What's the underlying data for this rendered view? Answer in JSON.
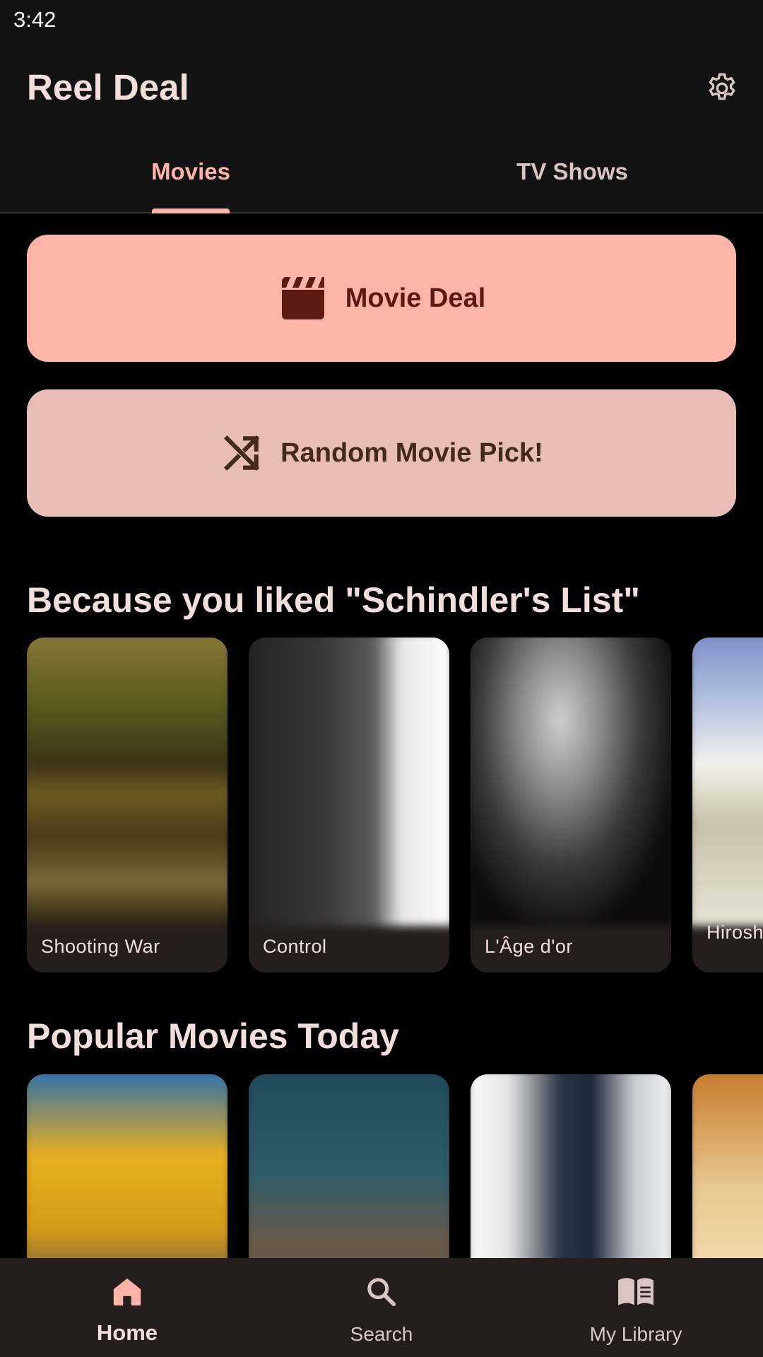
{
  "status_bar": {
    "time": "3:42"
  },
  "app_bar": {
    "title": "Reel Deal",
    "settings_icon": "gear-icon"
  },
  "tabs": [
    {
      "label": "Movies",
      "active": true
    },
    {
      "label": "TV Shows",
      "active": false
    }
  ],
  "actions": {
    "deal": {
      "label": "Movie Deal",
      "icon": "clapperboard-icon",
      "color": "#ffb4a8"
    },
    "random": {
      "label": "Random Movie Pick!",
      "icon": "shuffle-icon",
      "color": "#e7bdb6"
    }
  },
  "sections": [
    {
      "title": "Because you liked \"Schindler's List\"",
      "movies": [
        {
          "title": "Shooting War"
        },
        {
          "title": "Control"
        },
        {
          "title": "L'Âge d'or"
        },
        {
          "title": "Hiroshima Amour"
        }
      ]
    },
    {
      "title": "Popular Movies Today",
      "movies": [
        {
          "title": ""
        },
        {
          "title": ""
        },
        {
          "title": ""
        },
        {
          "title": ""
        }
      ]
    }
  ],
  "bottom_nav": [
    {
      "label": "Home",
      "icon": "home-icon",
      "active": true
    },
    {
      "label": "Search",
      "icon": "search-icon",
      "active": false
    },
    {
      "label": "My Library",
      "icon": "book-icon",
      "active": false
    }
  ],
  "colors": {
    "accent": "#ffb4a8",
    "surface": "#141313",
    "card": "#261e1d",
    "background": "#000000"
  }
}
